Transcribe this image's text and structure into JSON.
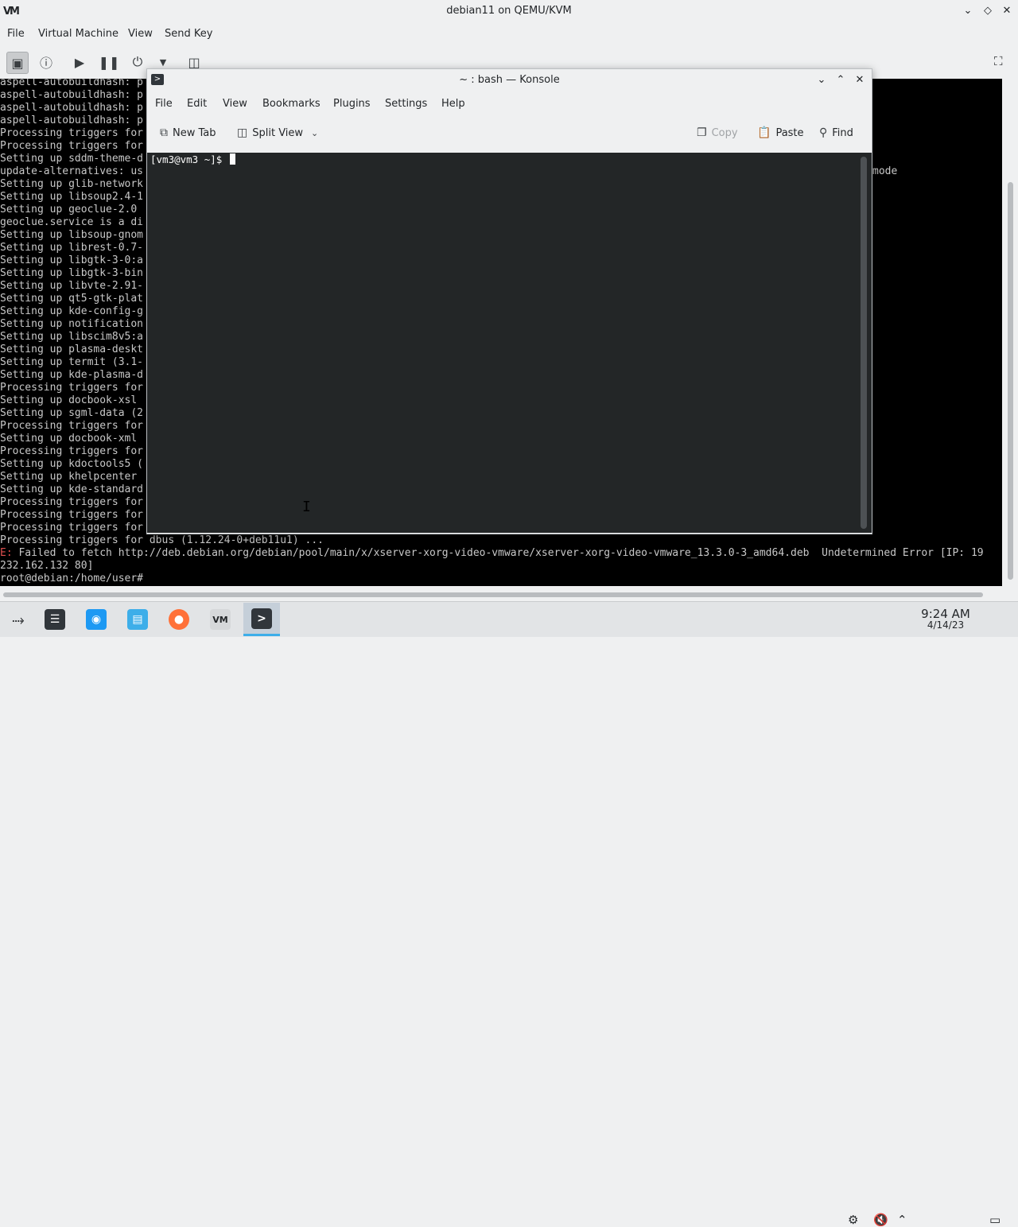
{
  "vm_window": {
    "logo": "VM",
    "title": "debian11 on QEMU/KVM",
    "menu": [
      "File",
      "Virtual Machine",
      "View",
      "Send Key"
    ],
    "window_buttons": [
      "minimize-icon",
      "restore-icon",
      "close-icon"
    ]
  },
  "toolbar_icons": [
    "monitor-icon",
    "info-icon",
    "play-icon",
    "pause-icon",
    "power-icon",
    "dropdown-arrow-icon",
    "screenshot-icon",
    "fullscreen-icon"
  ],
  "console_lines": [
    "aspell-autobuildhash: p",
    "aspell-autobuildhash: p",
    "aspell-autobuildhash: p",
    "aspell-autobuildhash: p",
    "Processing triggers for",
    "Processing triggers for",
    "Setting up sddm-theme-d",
    "update-alternatives: us",
    "Setting up glib-network",
    "Setting up libsoup2.4-1",
    "Setting up geoclue-2.0 ",
    "geoclue.service is a di",
    "Setting up libsoup-gnom",
    "Setting up librest-0.7-",
    "Setting up libgtk-3-0:a",
    "Setting up libgtk-3-bin",
    "Setting up libvte-2.91-",
    "Setting up qt5-gtk-plat",
    "Setting up kde-config-g",
    "Setting up notification",
    "Setting up libscim8v5:a",
    "Setting up plasma-deskt",
    "Setting up termit (3.1-",
    "Setting up kde-plasma-d",
    "Processing triggers for",
    "Setting up docbook-xsl ",
    "Setting up sgml-data (2",
    "Processing triggers for",
    "Setting up docbook-xml ",
    "Processing triggers for",
    "Setting up kdoctools5 (",
    "Setting up khelpcenter ",
    "Setting up kde-standard",
    "Processing triggers for",
    "Processing triggers for",
    "Processing triggers for",
    "Processing triggers for dbus (1.12.24-0+deb11u1) ..."
  ],
  "console_right_fragment": "mode",
  "console_error_prefix": "E:",
  "console_error_line": " Failed to fetch http://deb.debian.org/debian/pool/main/x/xserver-xorg-video-vmware/xserver-xorg-video-vmware_13.3.0-3_amd64.deb  Undetermined Error [IP: 19",
  "console_error_cont": "232.162.132 80]",
  "console_prompt": "root@debian:/home/user#",
  "konsole": {
    "title": "~ : bash — Konsole",
    "menu": [
      "File",
      "Edit",
      "View",
      "Bookmarks",
      "Plugins",
      "Settings",
      "Help"
    ],
    "new_tab": "New Tab",
    "split_view": "Split View",
    "copy": "Copy",
    "paste": "Paste",
    "find": "Find",
    "prompt": "[vm3@vm3 ~]$"
  },
  "taskbar": {
    "apps": [
      "app-launcher-icon",
      "activity-manager-icon",
      "discover-icon",
      "file-manager-icon",
      "firefox-icon",
      "virt-manager-icon",
      "konsole-icon"
    ],
    "time": "9:24 AM",
    "date": "4/14/23"
  }
}
